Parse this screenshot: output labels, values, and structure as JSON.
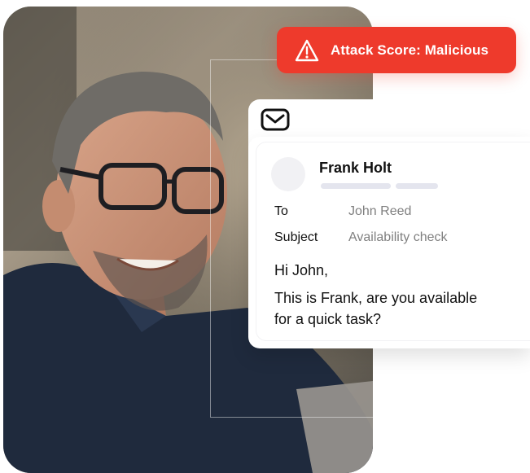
{
  "alert": {
    "text": "Attack Score: Malicious",
    "icon": "warning-triangle-icon",
    "color": "#ee3a2c"
  },
  "email": {
    "icon": "envelope-icon",
    "sender": "Frank Holt",
    "to_label": "To",
    "to_value": "John Reed",
    "subject_label": "Subject",
    "subject_value": "Availability check",
    "greeting": "Hi John,",
    "body_line1": "This is Frank, are you available",
    "body_line2": "for a quick task?"
  }
}
